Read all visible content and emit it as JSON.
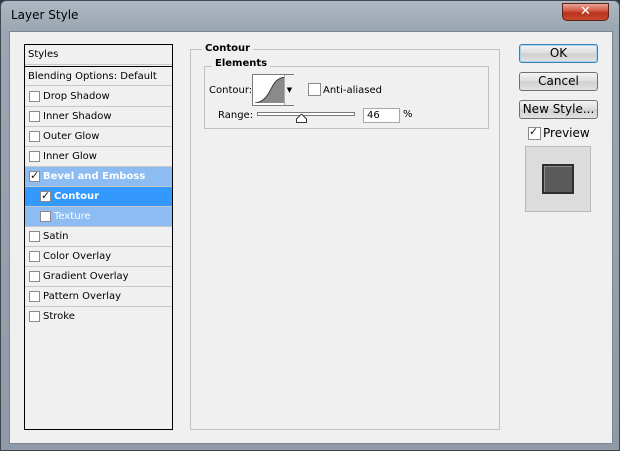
{
  "window": {
    "title": "Layer Style",
    "close_glyph": "✕"
  },
  "styles_panel": {
    "header": "Styles",
    "blending": "Blending Options: Default",
    "items": [
      {
        "label": "Drop Shadow",
        "checked": false
      },
      {
        "label": "Inner Shadow",
        "checked": false
      },
      {
        "label": "Outer Glow",
        "checked": false
      },
      {
        "label": "Inner Glow",
        "checked": false
      },
      {
        "label": "Bevel and Emboss",
        "checked": true
      },
      {
        "label": "Contour",
        "checked": true
      },
      {
        "label": "Texture",
        "checked": false
      },
      {
        "label": "Satin",
        "checked": false
      },
      {
        "label": "Color Overlay",
        "checked": false
      },
      {
        "label": "Gradient Overlay",
        "checked": false
      },
      {
        "label": "Pattern Overlay",
        "checked": false
      },
      {
        "label": "Stroke",
        "checked": false
      }
    ],
    "check_glyph": "✓"
  },
  "contour_panel": {
    "group_title": "Contour",
    "elements_title": "Elements",
    "contour_label": "Contour:",
    "dropdown_glyph": "▼",
    "anti_aliased_label": "Anti-aliased",
    "anti_aliased": false,
    "range_label": "Range:",
    "range_value": "46",
    "range_unit": "%"
  },
  "buttons": {
    "ok": "OK",
    "cancel": "Cancel",
    "new_style": "New Style..."
  },
  "preview": {
    "label": "Preview",
    "checked": true
  },
  "colors": {
    "selection_light": "#8cbcf2",
    "selection_active": "#3399ff",
    "preview_swatch": "#5a5a5a"
  }
}
